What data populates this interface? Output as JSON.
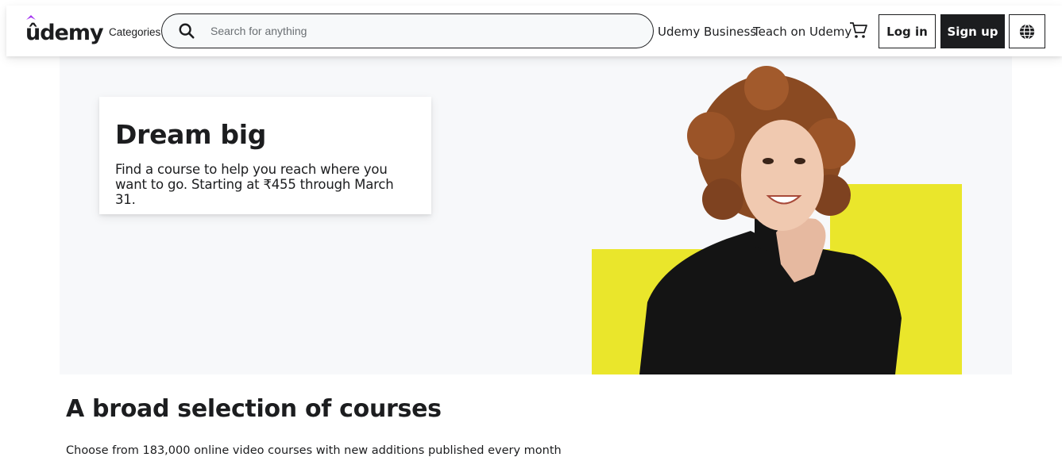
{
  "header": {
    "logo_text": "ûdemy",
    "categories_label": "Categories",
    "search_placeholder": "Search for anything",
    "business_link": "Udemy Business",
    "teach_link": "Teach on Udemy",
    "login_label": "Log in",
    "signup_label": "Sign up",
    "icons": {
      "search": "search-icon",
      "cart": "cart-icon",
      "language": "globe-icon",
      "logo": "udemy-logo"
    },
    "brand_color": "#a435f0"
  },
  "hero": {
    "title": "Dream big",
    "text": "Find a course to help you reach where you want to go. Starting at ₹455 through March 31.",
    "accent_color": "#eae62b"
  },
  "section": {
    "title": "A broad selection of courses",
    "subtitle": "Choose from 183,000 online video courses with new additions published every month"
  }
}
